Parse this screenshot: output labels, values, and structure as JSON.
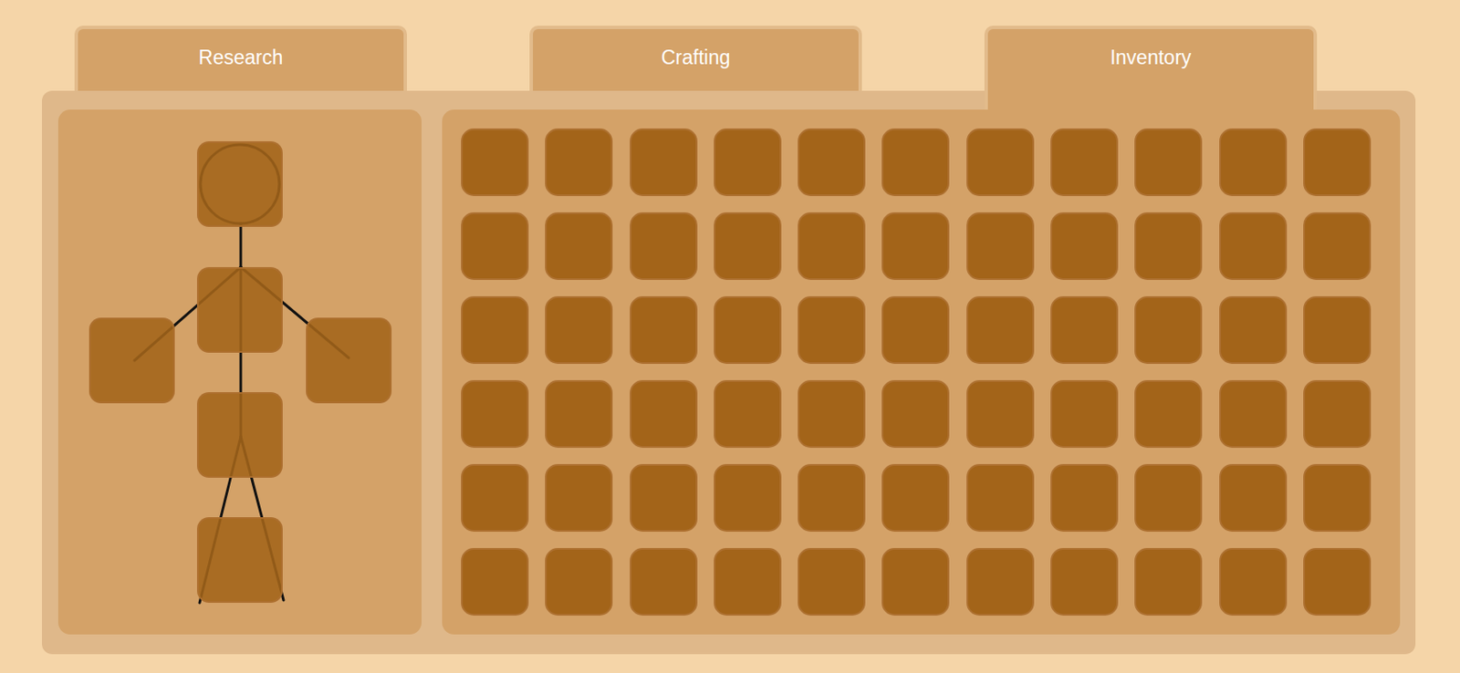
{
  "tabs": [
    {
      "label": "Research",
      "selected": false
    },
    {
      "label": "Crafting",
      "selected": false
    },
    {
      "label": "Inventory",
      "selected": true
    }
  ],
  "equipment": [
    {},
    {},
    {},
    {},
    {},
    {}
  ],
  "inventory": [
    {},
    {},
    {},
    {},
    {},
    {},
    {},
    {},
    {},
    {},
    {},
    {},
    {},
    {},
    {},
    {},
    {},
    {},
    {},
    {},
    {},
    {},
    {},
    {},
    {},
    {},
    {},
    {},
    {},
    {},
    {},
    {},
    {},
    {},
    {},
    {},
    {},
    {},
    {},
    {},
    {},
    {},
    {},
    {},
    {},
    {},
    {},
    {},
    {},
    {},
    {},
    {},
    {},
    {},
    {},
    {},
    {},
    {},
    {},
    {},
    {},
    {},
    {},
    {},
    {},
    {}
  ]
}
